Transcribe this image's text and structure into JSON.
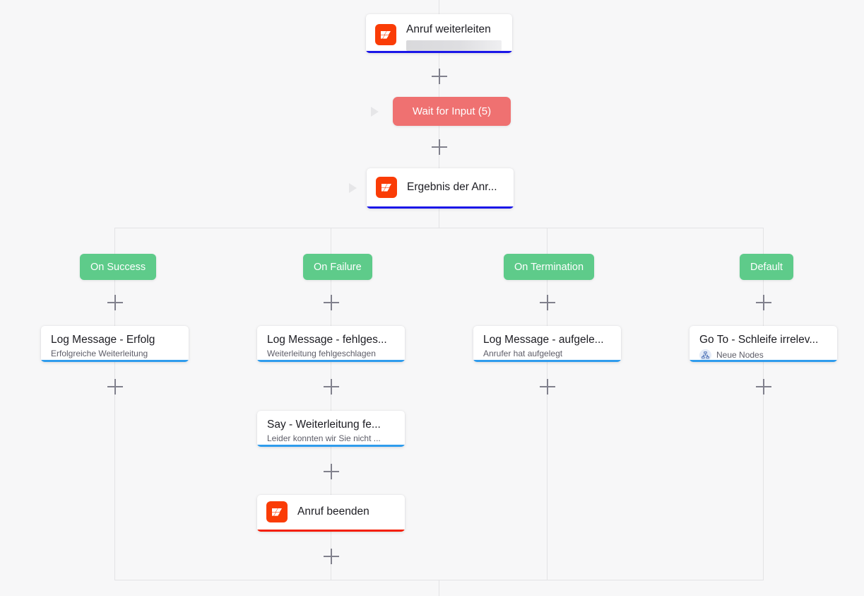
{
  "canvas": {
    "background": "#f7f7f8",
    "line_color": "#e3e3e5"
  },
  "colors": {
    "node_icon_bg": "#fa3c06",
    "underline_blue": "#1a16e8",
    "underline_lightblue": "#2f9ced",
    "underline_red": "#f51f04",
    "pill_wait": "#ef7171",
    "pill_branch": "#5ecb8a",
    "plus": "#81818d"
  },
  "nodes": {
    "transfer_call": {
      "title": "Anruf weiterleiten",
      "icon": "zoom-logo-icon",
      "has_skeleton": true,
      "underline": "#1a16e8"
    },
    "wait_for_input": {
      "label": "Wait for Input (5)"
    },
    "call_result": {
      "title": "Ergebnis der Anr...",
      "icon": "zoom-logo-icon",
      "underline": "#1a16e8"
    },
    "log_success": {
      "title": "Log Message - Erfolg",
      "subtitle": "Erfolgreiche Weiterleitung",
      "underline": "#2f9ced"
    },
    "log_failure": {
      "title": "Log Message - fehlges...",
      "subtitle": "Weiterleitung fehlgeschlagen",
      "underline": "#2f9ced"
    },
    "log_hangup": {
      "title": "Log Message - aufgele...",
      "subtitle": "Anrufer hat aufgelegt",
      "underline": "#2f9ced"
    },
    "go_to_loop": {
      "title": "Go To - Schleife irrelev...",
      "subtitle": "Neue Nodes",
      "sub_icon": "node-tree-icon",
      "underline": "#2f9ced"
    },
    "say_failure": {
      "title": "Say - Weiterleitung fe...",
      "subtitle": "Leider konnten wir Sie nicht ...",
      "underline": "#2f9ced"
    },
    "end_call": {
      "title": "Anruf beenden",
      "icon": "zoom-logo-icon",
      "underline": "#f51f04"
    }
  },
  "branches": [
    {
      "label": "On Success"
    },
    {
      "label": "On Failure"
    },
    {
      "label": "On Termination"
    },
    {
      "label": "Default"
    }
  ]
}
